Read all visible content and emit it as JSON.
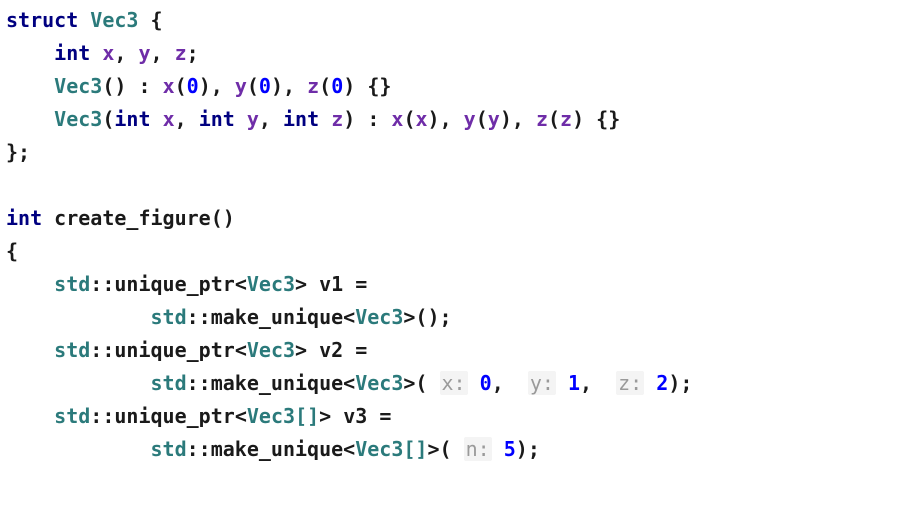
{
  "struct_kw": "struct",
  "Vec3": "Vec3",
  "int_kw": "int",
  "field_x": "x",
  "field_y": "y",
  "field_z": "z",
  "zero": "0",
  "one": "1",
  "two": "2",
  "five": "5",
  "ctor0": "Vec3",
  "ctor1": "Vec3",
  "fn_name": "create_figure",
  "std": "std",
  "unique_ptr": "unique_ptr",
  "make_unique": "make_unique",
  "v1": "v1",
  "v2": "v2",
  "v3": "v3",
  "Vec3Arr": "Vec3[]",
  "hint_x": "x:",
  "hint_y": "y:",
  "hint_z": "z:",
  "hint_n": "n:",
  "chart_data": {
    "type": "table",
    "title": "C++ code snippet",
    "lines": [
      "struct Vec3 {",
      "    int x, y, z;",
      "    Vec3() : x(0), y(0), z(0) {}",
      "    Vec3(int x, int y, int z) : x(x), y(y), z(z) {}",
      "};",
      "",
      "int create_figure()",
      "{",
      "    std::unique_ptr<Vec3> v1 =",
      "            std::make_unique<Vec3>();",
      "    std::unique_ptr<Vec3> v2 =",
      "            std::make_unique<Vec3>( x: 0,  y: 1,  z: 2);",
      "    std::unique_ptr<Vec3[]> v3 =",
      "            std::make_unique<Vec3[]>( n: 5);"
    ]
  }
}
